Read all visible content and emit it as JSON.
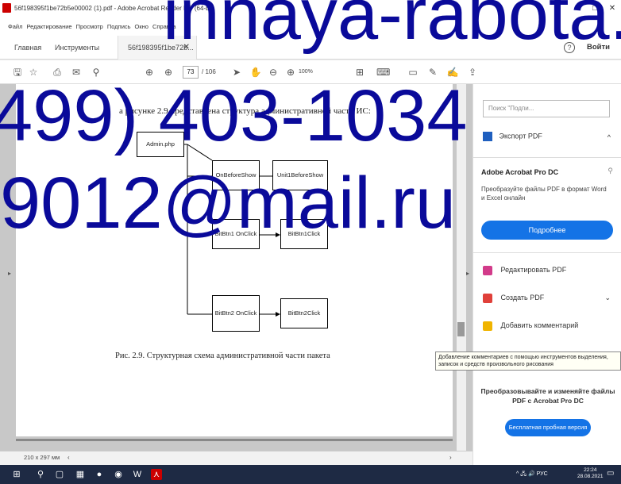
{
  "window": {
    "title": "56f198395f1be72b5e00002 (1).pdf - Adobe Acrobat Reader DC (64-bit)",
    "controls": [
      "–",
      "□",
      "✕"
    ]
  },
  "menu": [
    "Файл",
    "Редактирование",
    "Просмотр",
    "Подпись",
    "Окно",
    "Справка"
  ],
  "tabs": {
    "home": "Главная",
    "tools": "Инструменты",
    "doc": "56f198395f1be72b...",
    "doc_close": "✕",
    "help": "?",
    "signin": "Войти"
  },
  "toolbar": {
    "page_current": "73",
    "page_total": "/ 106",
    "zoom": "100%",
    "icons": [
      "save-icon",
      "star-icon",
      "print-icon",
      "search-icon",
      "upload-icon",
      "prev-page-icon",
      "next-page-icon",
      "cursor-icon",
      "hand-icon",
      "zoom-out-icon",
      "zoom-in-icon",
      "fit-icon",
      "keyboard-icon",
      "comment-icon",
      "pen-icon",
      "sign-icon",
      "share-icon"
    ]
  },
  "document": {
    "heading": "а рисунке 2.9 представлена структура административной части ИС:",
    "boxes": {
      "admin": "Admin.php",
      "onbefore": "OnBeforeShow",
      "unit1": "Unit1BeforeShow",
      "bitbtn1": "BitBtn1 OnClick",
      "bitbtn1click": "BitBtn1Click",
      "bitbtn2": "BitBtn2 OnClick",
      "bitbtn2click": "BitBtn2Click"
    },
    "caption": "Рис. 2.9. Структурная схема административной части пакета"
  },
  "status": {
    "page_size": "210 x 297 мм",
    "left_arrow": "‹",
    "right_arrow": "›"
  },
  "right_pane": {
    "search_placeholder": "Поиск \"Подпи...",
    "export": "Экспорт PDF",
    "product": "Adobe Acrobat Pro DC",
    "product_desc": "Преобразуйте файлы PDF в формат Word и Excel онлайн",
    "more_button": "Подробнее",
    "edit": "Редактировать PDF",
    "create": "Создать PDF",
    "comment": "Добавить комментарий",
    "promo": "Преобразовывайте и изменяйте файлы PDF с Acrobat Pro DC",
    "trial_button": "Бесплатная пробная версия"
  },
  "tooltip": "Добавление комментариев с помощью инструментов выделения, записок и средств произвольного рисования",
  "taskbar": {
    "tray": "^ 🖧 🔊 РУС",
    "time": "22:24",
    "date": "28.08.2021"
  },
  "watermark": {
    "line1": "innaya-rabota.",
    "line2": "499) 403-1034",
    "line3": "9012@mail.ru"
  },
  "colors": {
    "accent": "#1473e6",
    "watermark": "#0a0a9a",
    "taskbar": "#1e2a44"
  }
}
